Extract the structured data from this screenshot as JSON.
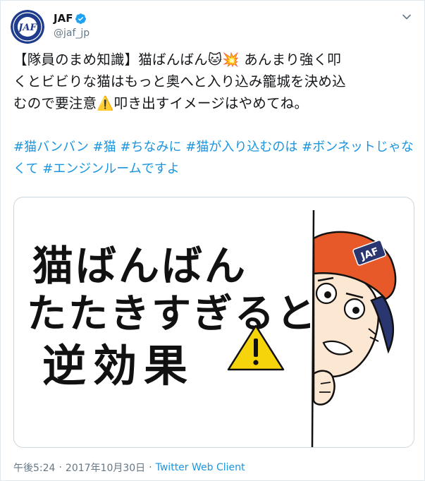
{
  "account": {
    "display_name": "JAF",
    "handle": "@jaf_jp",
    "avatar_label": "JAF"
  },
  "tweet": {
    "lines": [
      "【隊員のまめ知識】猫ばんばん🐱💥 あんまり強く叩",
      "くとビビりな猫はもっと奥へと入り込み籠城を決め込",
      "むので要注意⚠️叩き出すイメージはやめてね。"
    ],
    "hashtags": [
      "#猫バンバン",
      "#猫",
      "#ちなみに",
      "#猫が入り込むのは",
      "#ボンネットじゃなくて",
      "#エンジンルームですよ"
    ]
  },
  "media": {
    "title_lines": [
      "猫ばんばん",
      "たたきすぎると",
      "逆効果"
    ],
    "cap_label": "JAF"
  },
  "footer": {
    "time": "午後5:24",
    "date": "2017年10月30日",
    "separator": "·",
    "client": "Twitter Web Client"
  },
  "colors": {
    "link": "#1b95e0",
    "secondary_text": "#657786",
    "primary_text": "#14171a",
    "avatar_bg": "#1f3b8c",
    "cap_orange": "#e8592a",
    "cap_navy": "#2a3670",
    "warning_yellow": "#f5d40b"
  }
}
